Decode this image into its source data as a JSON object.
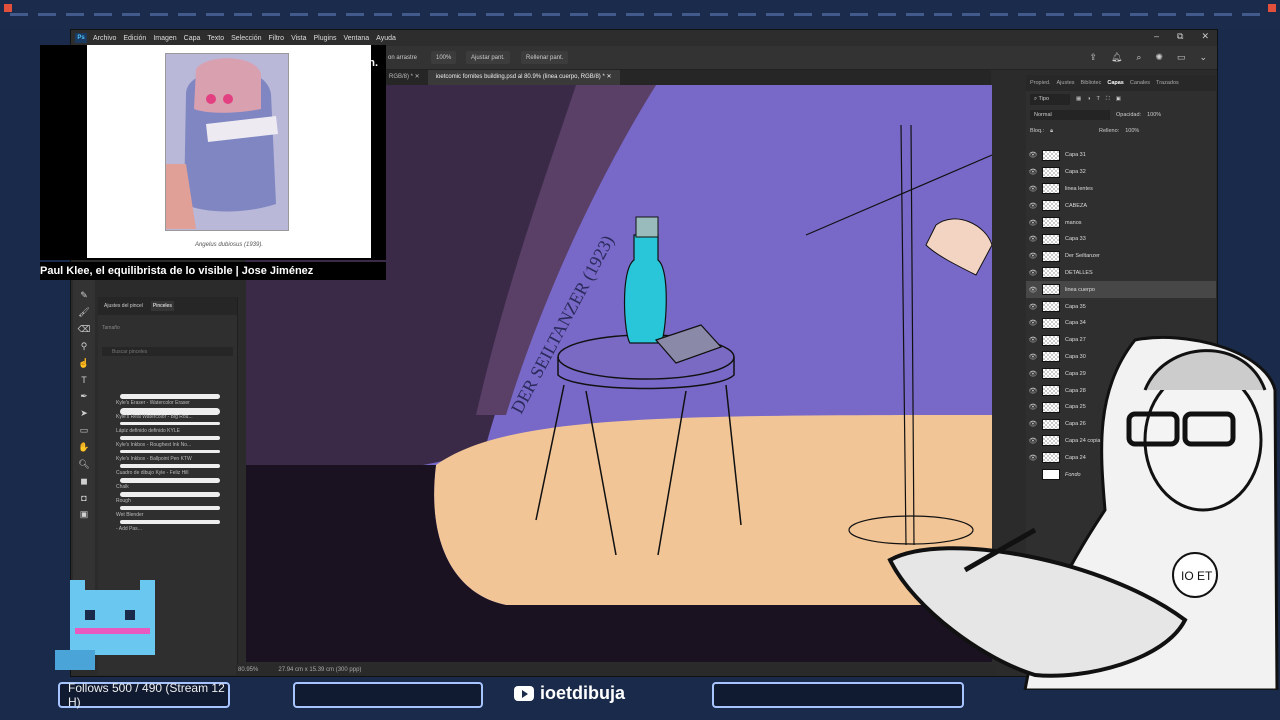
{
  "menu": {
    "app_icon": "Ps",
    "items": [
      "Archivo",
      "Edición",
      "Imagen",
      "Capa",
      "Texto",
      "Selección",
      "Filtro",
      "Vista",
      "Plugins",
      "Ventana",
      "Ayuda"
    ],
    "win_min": "–",
    "win_max": "⧉",
    "win_close": "✕"
  },
  "options": {
    "drag": "on arrastre",
    "zoom": "100%",
    "fit": "Ajustar pant.",
    "fill": "Rellenar pant."
  },
  "tabs": {
    "tab1": "RGB/8) *",
    "tab2": "ioetcomic fornites building.psd al 80.9% (linea cuerpo, RGB/8) *"
  },
  "brushes": {
    "tab1": "Ajustes del pincel",
    "tab2": "Pinceles",
    "size_label": "Tamaño",
    "search_placeholder": "Buscar pinceles",
    "items": [
      "Kyle's Eraser - Watercolor Eraser",
      "Kyle's Real Watercolor - Big Rou...",
      "Lápiz definido definido KYLE",
      "Kyle's Inkbox - Roughest Ink No...",
      "Kyle's Inkbox - Ballpoint Pen KTW",
      "Cuadro de dibujo Kyle - Feliz Hill",
      "Chalk",
      "Rough",
      "Wet Blender",
      "- Add Pas..."
    ]
  },
  "status": {
    "zoom": "80.95%",
    "dims": "27.94 cm x 15.39 cm (300 ppp)"
  },
  "canvas": {
    "lettering": "DER SEILTANZER (1923)"
  },
  "layers_panel": {
    "tabs": [
      "Propied.",
      "Ajustes",
      "Bibliotec",
      "Capas",
      "Canales",
      "Trazados"
    ],
    "active_tab": "Capas",
    "filter": "Tipo",
    "blend": "Normal",
    "opacity_label": "Opacidad:",
    "opacity": "100%",
    "lock_label": "Bloq.:",
    "fill_label": "Relleno:",
    "fill": "100%",
    "layers": [
      "Capa 31",
      "Capa 32",
      "linea lentes",
      "CABEZA",
      "manos",
      "Capa 33",
      "Der Seiltanzer",
      "DETALLES",
      "linea cuerpo",
      "Capa 35",
      "Capa 34",
      "Capa 27",
      "Capa 30",
      "Capa 29",
      "Capa 28",
      "Capa 25",
      "Capa 26",
      "Capa 24 copia",
      "Capa 24",
      "Fondo"
    ],
    "selected": "linea cuerpo"
  },
  "overlay": {
    "caption": "Angelus dubiosus (1939).",
    "corner_text": "march.",
    "title": "Paul Klee, el equilibrista de lo visible | Jose Jiménez"
  },
  "bottom": {
    "follows": "Follows 500 / 490 (Stream 12 H)",
    "channel": "ioetdibuja"
  },
  "avatar": {
    "shirt_text": "IO ET"
  },
  "colors": {
    "frame": "#1b2b4b",
    "accent": "#a8c4ff",
    "canvas_purple": "#7b6ad0",
    "canvas_peach": "#f4c89a"
  }
}
